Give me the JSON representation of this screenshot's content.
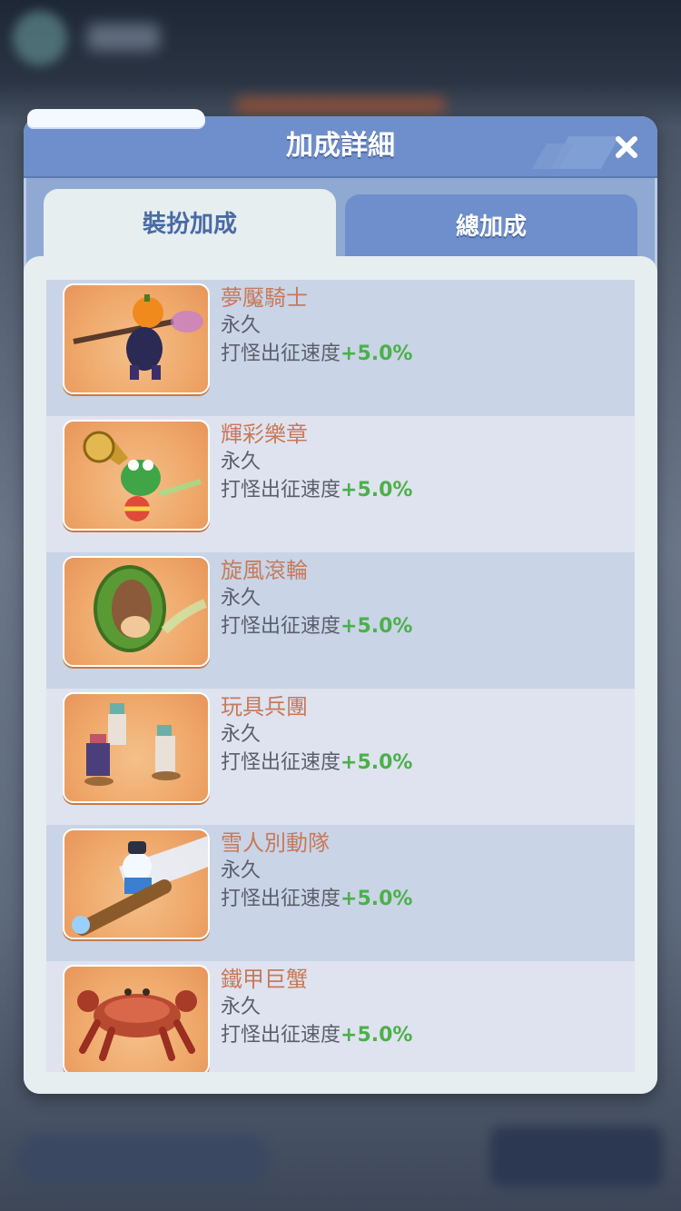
{
  "dialog": {
    "title": "加成詳細",
    "close_icon": "close-icon",
    "tabs": [
      {
        "label": "裝扮加成",
        "active": true
      },
      {
        "label": "總加成",
        "active": false
      }
    ]
  },
  "items": [
    {
      "name": "夢魘騎士",
      "duration": "永久",
      "effect_label": "打怪出征速度",
      "effect_value": "+5.0%",
      "icon": "pumpkin-knight-icon"
    },
    {
      "name": "輝彩樂章",
      "duration": "永久",
      "effect_label": "打怪出征速度",
      "effect_value": "+5.0%",
      "icon": "horn-frog-icon"
    },
    {
      "name": "旋風滾輪",
      "duration": "永久",
      "effect_label": "打怪出征速度",
      "effect_value": "+5.0%",
      "icon": "hamster-wheel-icon"
    },
    {
      "name": "玩具兵團",
      "duration": "永久",
      "effect_label": "打怪出征速度",
      "effect_value": "+5.0%",
      "icon": "toy-soldiers-icon"
    },
    {
      "name": "雪人別動隊",
      "duration": "永久",
      "effect_label": "打怪出征速度",
      "effect_value": "+5.0%",
      "icon": "snowman-cannon-icon"
    },
    {
      "name": "鐵甲巨蟹",
      "duration": "永久",
      "effect_label": "打怪出征速度",
      "effect_value": "+5.0%",
      "icon": "armored-crab-icon"
    }
  ],
  "colors": {
    "header": "#6e8fcb",
    "panel": "#e6eef0",
    "item_name": "#c8795a",
    "bonus_value": "#4cb04a"
  }
}
